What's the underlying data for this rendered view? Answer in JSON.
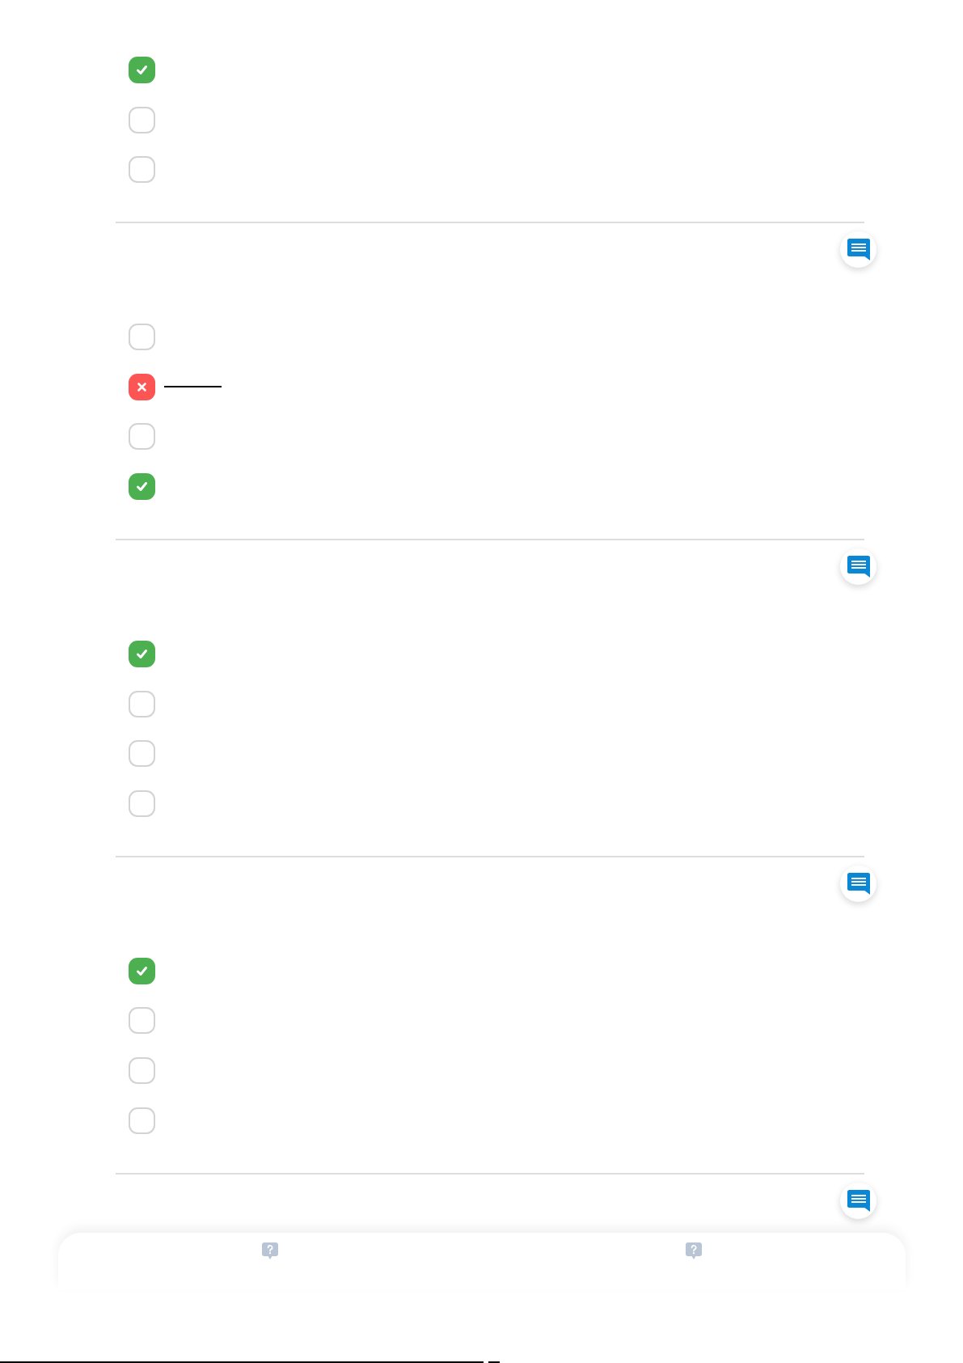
{
  "questions": [
    {
      "options": [
        {
          "checked": true,
          "correct": true
        },
        {
          "checked": false
        },
        {
          "checked": false
        }
      ]
    },
    {
      "options": [
        {
          "checked": false
        },
        {
          "checked": true,
          "correct": false
        },
        {
          "checked": false
        },
        {
          "checked": true,
          "correct": true
        }
      ]
    },
    {
      "options": [
        {
          "checked": true,
          "correct": true
        },
        {
          "checked": false
        },
        {
          "checked": false
        },
        {
          "checked": false
        }
      ]
    },
    {
      "options": [
        {
          "checked": true,
          "correct": true
        },
        {
          "checked": false
        },
        {
          "checked": false
        },
        {
          "checked": false
        }
      ]
    }
  ]
}
